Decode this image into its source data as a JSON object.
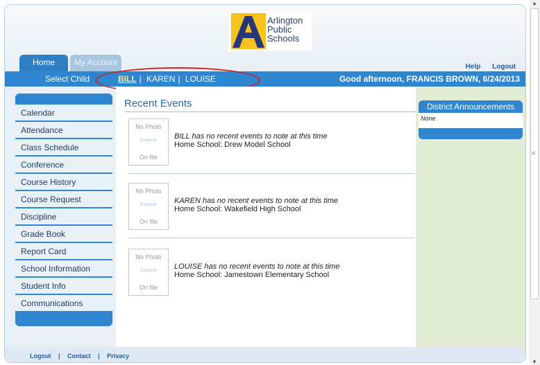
{
  "logo": {
    "line1": "Arlington",
    "line2": "Public",
    "line3": "Schools"
  },
  "tabs": {
    "home": "Home",
    "account": "My Account"
  },
  "top_links": {
    "help": "Help",
    "logout": "Logout"
  },
  "select_child": {
    "label": "Select Child",
    "children": [
      "BILL",
      "KAREN",
      "LOUISE"
    ],
    "active": "BILL"
  },
  "greeting": "Good afternoon, FRANCIS BROWN, 6/24/2013",
  "sidebar": {
    "items": [
      {
        "label": "Calendar"
      },
      {
        "label": "Attendance"
      },
      {
        "label": "Class Schedule"
      },
      {
        "label": "Conference"
      },
      {
        "label": "Course History"
      },
      {
        "label": "Course Request"
      },
      {
        "label": "Discipline"
      },
      {
        "label": "Grade Book"
      },
      {
        "label": "Report Card"
      },
      {
        "label": "School Information"
      },
      {
        "label": "Student Info"
      },
      {
        "label": "Communications"
      }
    ]
  },
  "recent_events": {
    "title": "Recent Events",
    "photo_placeholder": {
      "line1": "No Photo",
      "brand": "Edupoint",
      "line3": "On file"
    },
    "events": [
      {
        "text": "BILL has no recent events to note at this time",
        "school": "Home School: Drew Model School"
      },
      {
        "text": "KAREN has no recent events to note at this time",
        "school": "Home School: Wakefield High School"
      },
      {
        "text": "LOUISE has no recent events to note at this time",
        "school": "Home School: Jamestown Elementary School"
      }
    ]
  },
  "announcements": {
    "title": "District Announcements",
    "body": "None"
  },
  "footer": {
    "logout": "Logout",
    "contact": "Contact",
    "privacy": "Privacy",
    "sep": "|"
  },
  "colors": {
    "primary": "#2e86d0",
    "accent_logo": "#f6c31c",
    "highlight_oval": "#cc2222"
  }
}
